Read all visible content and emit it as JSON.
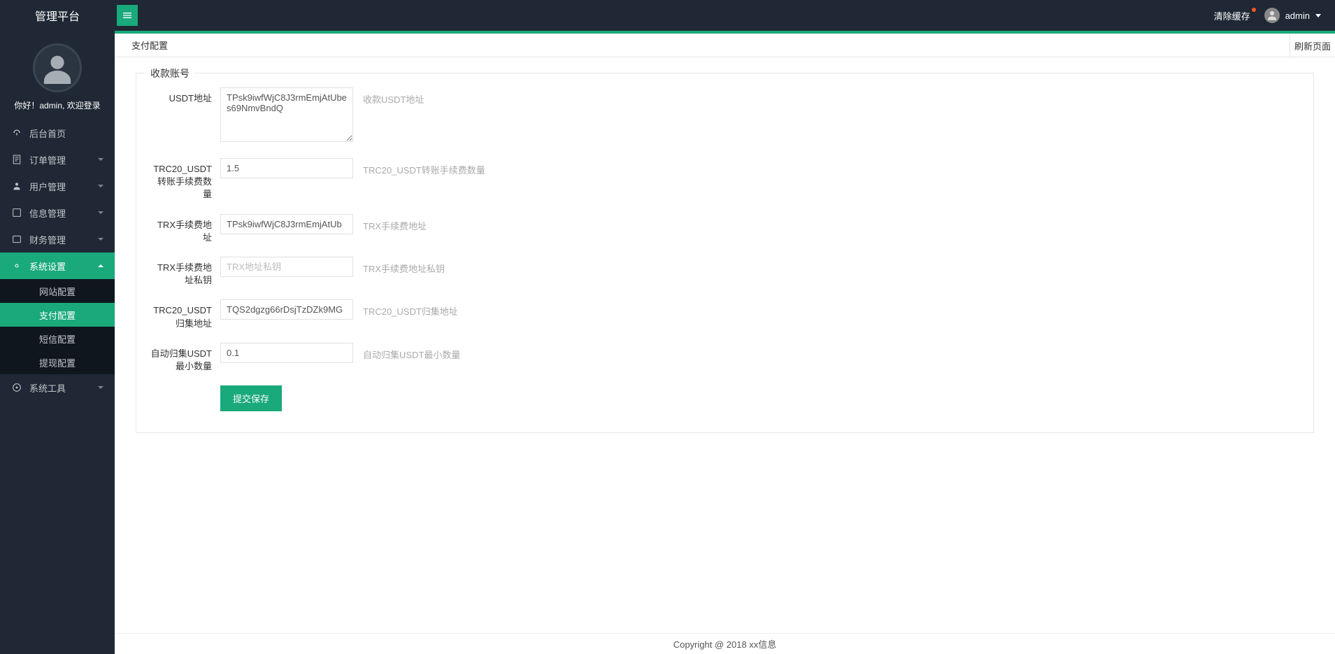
{
  "header": {
    "title": "管理平台",
    "clear_cache": "清除缓存",
    "username": "admin"
  },
  "sidebar": {
    "welcome": "你好！admin, 欢迎登录",
    "menu": [
      {
        "label": "后台首页",
        "icon": "dashboard",
        "expandable": false
      },
      {
        "label": "订单管理",
        "icon": "order",
        "expandable": true
      },
      {
        "label": "用户管理",
        "icon": "user",
        "expandable": true
      },
      {
        "label": "信息管理",
        "icon": "info",
        "expandable": true
      },
      {
        "label": "财务管理",
        "icon": "finance",
        "expandable": true
      },
      {
        "label": "系统设置",
        "icon": "settings",
        "expandable": true,
        "open": true,
        "children": [
          {
            "label": "网站配置"
          },
          {
            "label": "支付配置",
            "active": true
          },
          {
            "label": "短信配置"
          },
          {
            "label": "提现配置"
          }
        ]
      },
      {
        "label": "系统工具",
        "icon": "tool",
        "expandable": true
      }
    ]
  },
  "tabs": {
    "active": "支付配置",
    "refresh": "刷新页面"
  },
  "form": {
    "fieldset_title": "收款账号",
    "rows": [
      {
        "label": "USDT地址",
        "type": "textarea",
        "value": "TPsk9iwfWjC8J3rmEmjAtUbes69NmvBndQ",
        "placeholder": "",
        "hint": "收款USDT地址"
      },
      {
        "label": "TRC20_USDT转账手续费数量",
        "type": "text",
        "value": "1.5",
        "placeholder": "",
        "hint": "TRC20_USDT转账手续费数量"
      },
      {
        "label": "TRX手续费地址",
        "type": "text",
        "value": "TPsk9iwfWjC8J3rmEmjAtUb",
        "placeholder": "",
        "hint": "TRX手续费地址"
      },
      {
        "label": "TRX手续费地址私钥",
        "type": "text",
        "value": "",
        "placeholder": "TRX地址私钥",
        "hint": "TRX手续费地址私钥"
      },
      {
        "label": "TRC20_USDT归集地址",
        "type": "text",
        "value": "TQS2dgzg66rDsjTzDZk9MG",
        "placeholder": "",
        "hint": "TRC20_USDT归集地址"
      },
      {
        "label": "自动归集USDT最小数量",
        "type": "text",
        "value": "0.1",
        "placeholder": "",
        "hint": "自动归集USDT最小数量"
      }
    ],
    "submit": "提交保存"
  },
  "footer": "Copyright @ 2018 xx信息"
}
